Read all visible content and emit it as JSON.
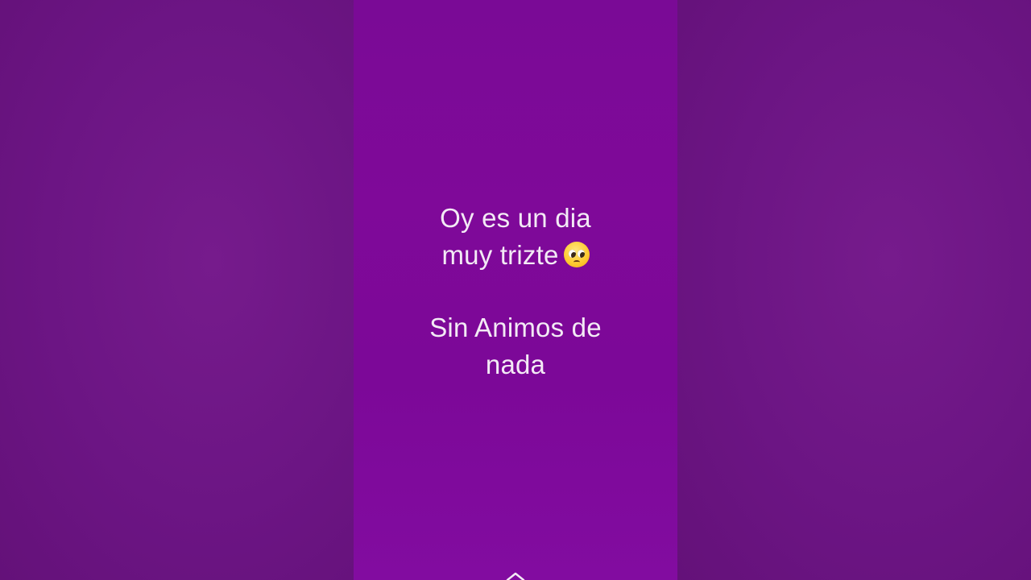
{
  "story": {
    "line1": "Oy es un dia",
    "line2": "muy trizte",
    "emoji_icon": "pleading-face-icon",
    "line3": "Sin Animos de",
    "line4": "nada"
  },
  "controls": {
    "swipe_icon": "chevron-up-icon"
  },
  "colors": {
    "story_background": "#7f0999",
    "side_background": "#6e1686",
    "text": "#f3eaf5"
  }
}
